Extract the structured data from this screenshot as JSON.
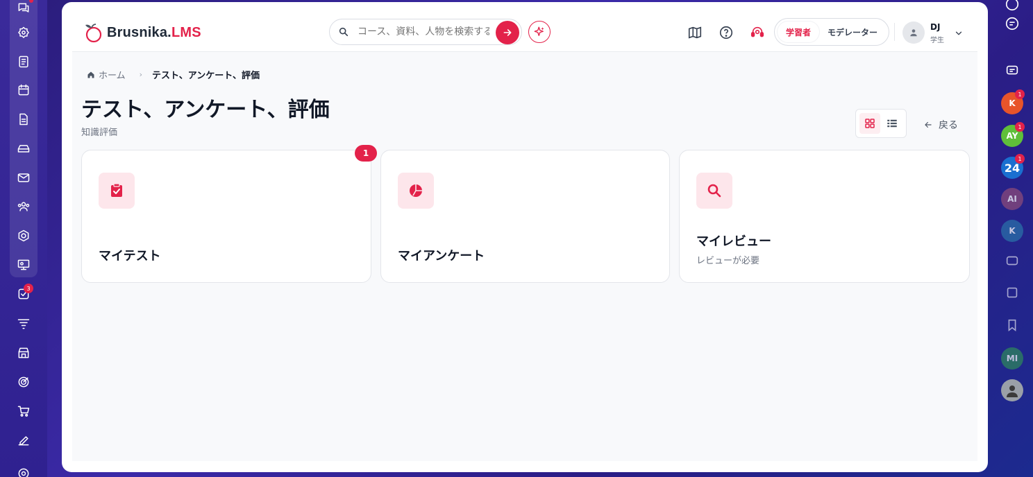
{
  "app": {
    "logo_main": "Brusnika.",
    "logo_accent": "LMS"
  },
  "search": {
    "placeholder": "コース、資料、人物を検索する"
  },
  "roles": {
    "active": "学習者",
    "inactive": "モデレーター"
  },
  "user": {
    "initials": "DJ",
    "role": "学生"
  },
  "breadcrumb": {
    "home": "ホーム",
    "separator": "›",
    "current": "テスト、アンケート、評価"
  },
  "page": {
    "title": "テスト、アンケート、評価",
    "subtitle": "知識評価",
    "back_label": "戻る"
  },
  "cards": [
    {
      "title": "マイテスト",
      "subtitle": "",
      "badge": "1",
      "icon": "clipboard-check-icon"
    },
    {
      "title": "マイアンケート",
      "subtitle": "",
      "badge": "",
      "icon": "pie-chart-icon"
    },
    {
      "title": "マイレビュー",
      "subtitle": "レビューが必要",
      "badge": "",
      "icon": "search-icon"
    }
  ],
  "left_rail": {
    "tasks_badge": "3"
  },
  "right_rail": {
    "avatars": [
      {
        "label": "K",
        "badge": "1",
        "color": "#e8542a"
      },
      {
        "label": "AY",
        "badge": "1",
        "color": "#5fbf3a"
      },
      {
        "label": "24",
        "badge": "1",
        "color": "#1a6fd0"
      },
      {
        "label": "AI",
        "badge": "",
        "color": "#8a4a7a"
      },
      {
        "label": "K",
        "badge": "",
        "color": "#2a6fa8"
      },
      {
        "label": "MI",
        "badge": "",
        "color": "#2f8a5a"
      }
    ]
  },
  "colors": {
    "accent": "#e3224a",
    "icon_bg": "#fde6eb"
  }
}
